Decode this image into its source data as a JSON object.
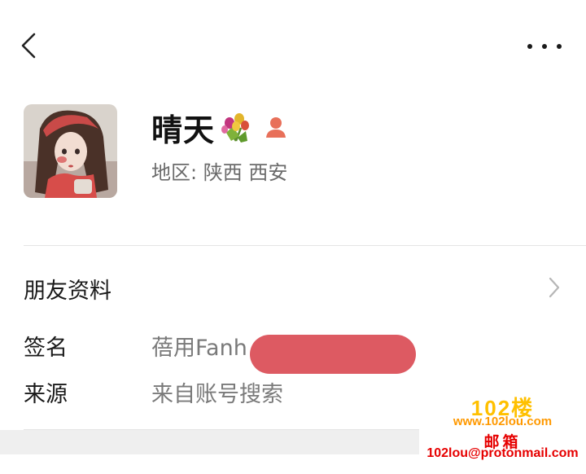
{
  "header": {
    "back_icon": "chevron-left-icon",
    "more_icon": "more-horizontal-icon"
  },
  "profile": {
    "nickname": "晴天",
    "flower_icon": "flower-bouquet-icon",
    "gender_icon": "female-user-icon",
    "gender_color": "#e8705a",
    "region": "地区:  陕西  西安"
  },
  "friend_info": {
    "label": "朋友资料",
    "chevron_icon": "chevron-right-icon"
  },
  "signature": {
    "label": "签名",
    "value": "蓓用Fanh",
    "redaction_color": "#dd5a62"
  },
  "source": {
    "label": "来源",
    "value": "来自账号搜索"
  },
  "watermark": {
    "logo": "102楼",
    "url": "www.102lou.com",
    "mail_label": "邮箱",
    "email": "102lou@protonmail.com"
  }
}
